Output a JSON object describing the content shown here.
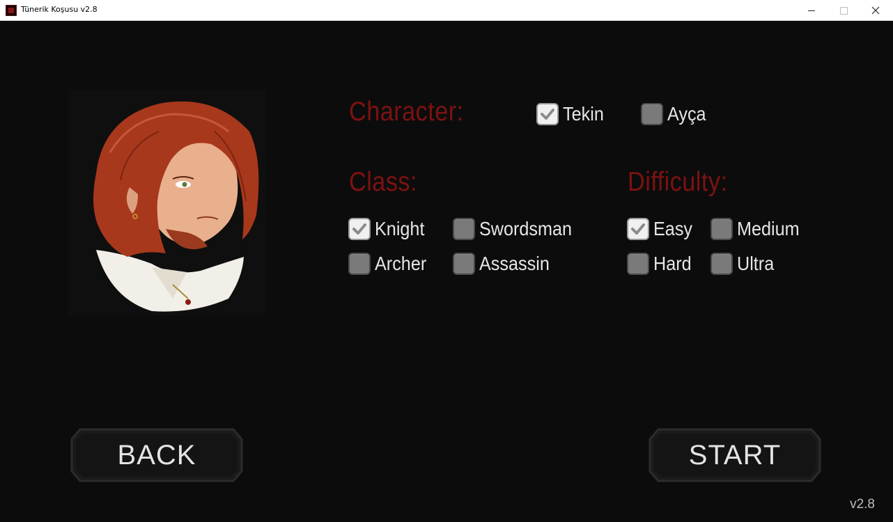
{
  "window": {
    "title": "Tünerik Koşusu v2.8",
    "icon": "game-app-icon",
    "controls": [
      "minimize",
      "maximize",
      "close"
    ]
  },
  "portrait": {
    "icon": "character-portrait-red-haired-man"
  },
  "character": {
    "heading": "Character:",
    "options": [
      {
        "label": "Tekin",
        "checked": true
      },
      {
        "label": "Ayça",
        "checked": false
      }
    ]
  },
  "class": {
    "heading": "Class:",
    "options": [
      {
        "label": "Knight",
        "checked": true
      },
      {
        "label": "Swordsman",
        "checked": false
      },
      {
        "label": "Archer",
        "checked": false
      },
      {
        "label": "Assassin",
        "checked": false
      }
    ]
  },
  "difficulty": {
    "heading": "Difficulty:",
    "options": [
      {
        "label": "Easy",
        "checked": true
      },
      {
        "label": "Medium",
        "checked": false
      },
      {
        "label": "Hard",
        "checked": false
      },
      {
        "label": "Ultra",
        "checked": false
      }
    ]
  },
  "buttons": {
    "back": "BACK",
    "start": "START"
  },
  "version": "v2.8",
  "colors": {
    "background": "#0c0c0c",
    "heading": "#7c1212",
    "label": "#e6e6e6",
    "checkbox_off": "#7a7a7a",
    "checkbox_on": "#f0f0f0"
  }
}
